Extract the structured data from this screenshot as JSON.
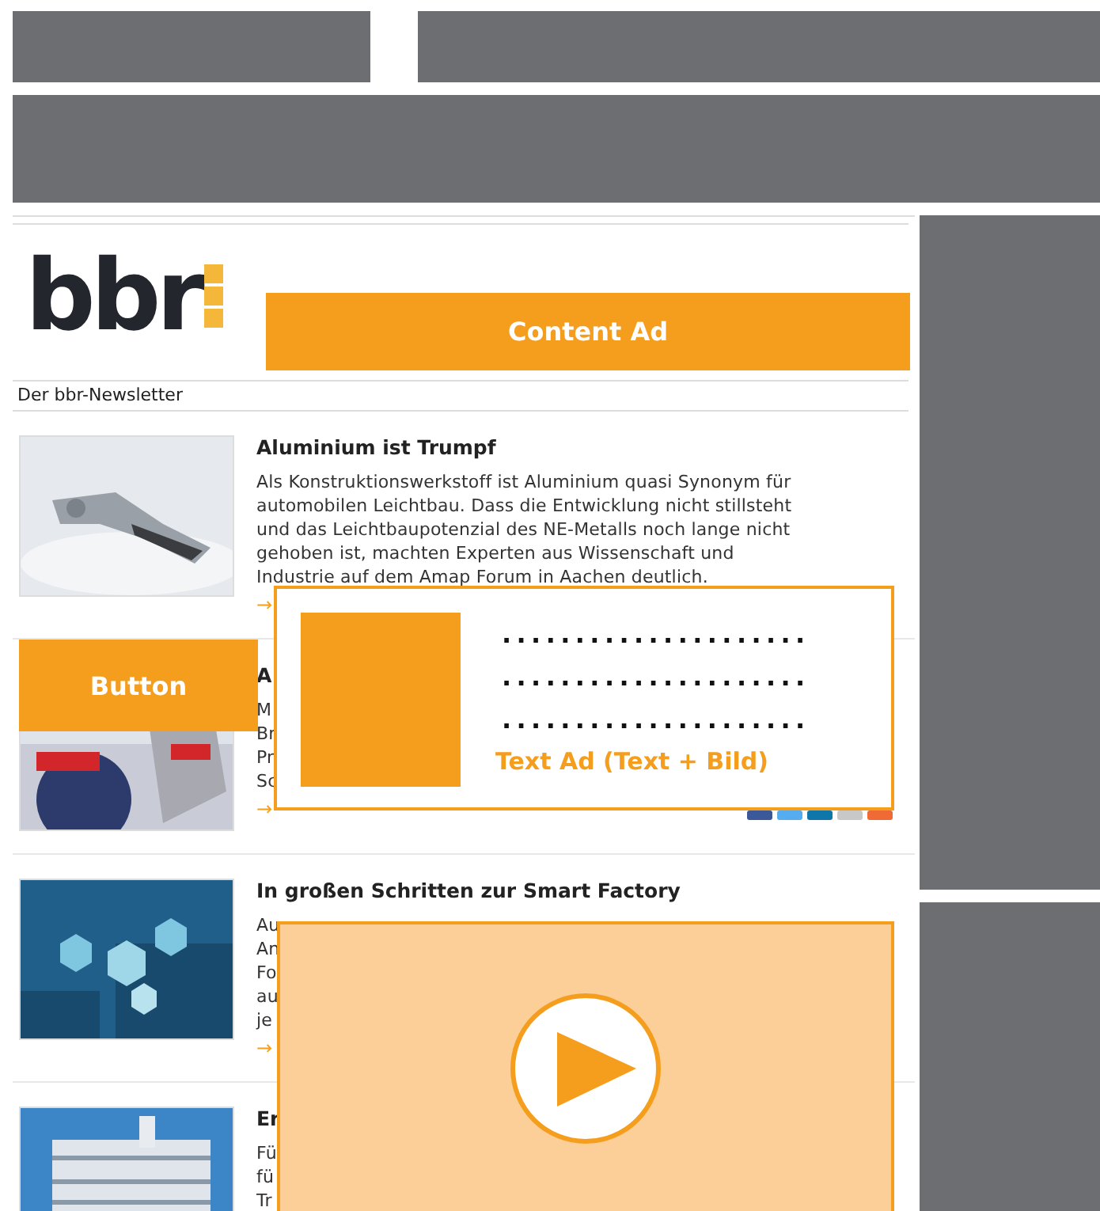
{
  "newsletter": {
    "logo": "bbr",
    "heading": "Der bbr-Newsletter",
    "articles": [
      {
        "title": "Aluminium ist Trumpf",
        "body": [
          "Als Konstruktionswerkstoff ist Aluminium quasi Synonym für",
          "automobilen Leichtbau. Dass die Entwicklung nicht stillsteht",
          "und das Leichtbaupotenzial des NE-Metalls noch lange nicht",
          "gehoben ist, machten Experten aus Wissenschaft und",
          "Industrie auf dem Amap Forum in Aachen deutlich."
        ],
        "more": "→"
      },
      {
        "title": "A",
        "body": [
          "M",
          "Br",
          "Pr",
          "Sc"
        ],
        "more": "→",
        "share": true
      },
      {
        "title": "In großen Schritten zur Smart Factory",
        "body": [
          "Au",
          "An",
          "Fo",
          "au",
          "je"
        ],
        "more": "→"
      },
      {
        "title": "Er",
        "body": [
          "Fü",
          "fü",
          "Tr"
        ]
      }
    ]
  },
  "ads": [
    {
      "kind": "content",
      "label": "Content Ad"
    },
    {
      "kind": "button",
      "label": "Button"
    },
    {
      "kind": "text",
      "label": "Text Ad (Text + Bild)",
      "lines": [
        ".....................",
        ".....................",
        "....................."
      ]
    },
    {
      "kind": "video"
    }
  ]
}
